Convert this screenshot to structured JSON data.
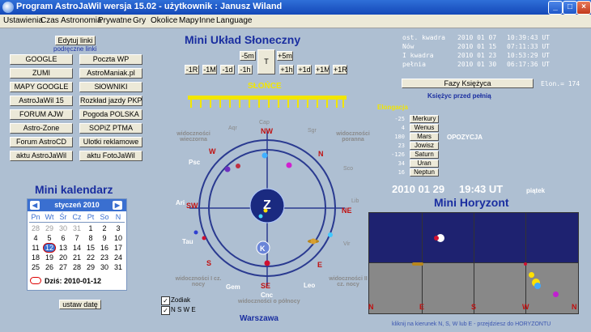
{
  "window": {
    "title": "Program AstroJaWil wersja 15.02 - użytkownik : Janusz Wiland"
  },
  "menu": [
    "Ustawienia",
    "Czas",
    "Astronomia",
    "Prywatne",
    "Gry",
    "Okolice",
    "Mapy",
    "Inne",
    "Language"
  ],
  "links": {
    "edit_button": "Edytuj linki",
    "caption": "podręczne linki",
    "left": [
      "GOOGLE",
      "ZUMI",
      "MAPY GOOGLE",
      "AstroJaWil 15",
      "FORUM AJW",
      "Astro-Zone",
      "Forum AstroCD",
      "aktu AstroJaWil"
    ],
    "right": [
      "Poczta WP",
      "AstroManiak.pl",
      "SłOWNIKI",
      "Rozkład jazdy PKP",
      "Pogoda POLSKA",
      "SOPiZ PTMA",
      "Ulotki reklamowe",
      "aktu FotoJaWil"
    ]
  },
  "calendar": {
    "title": "Mini kalendarz",
    "month": "styczeń 2010",
    "weekdays": [
      "Pn",
      "Wt",
      "Śr",
      "Cz",
      "Pt",
      "So",
      "N"
    ],
    "weeks": [
      [
        "28",
        "29",
        "30",
        "31",
        "1",
        "2",
        "3"
      ],
      [
        "4",
        "5",
        "6",
        "7",
        "8",
        "9",
        "10"
      ],
      [
        "11",
        "12",
        "13",
        "14",
        "15",
        "16",
        "17"
      ],
      [
        "18",
        "19",
        "20",
        "21",
        "22",
        "23",
        "24"
      ],
      [
        "25",
        "26",
        "27",
        "28",
        "29",
        "30",
        "31"
      ]
    ],
    "today_label": "Dziś: 2010-01-12",
    "set_date_button": "ustaw datę"
  },
  "solar": {
    "title": "Mini Układ Słoneczny",
    "sun_label": "SŁOŃCE",
    "buttons_top": [
      "-5m",
      "T",
      "+5m"
    ],
    "buttons_row": [
      "-1R",
      "-1M",
      "-1d",
      "-1h",
      "+1h",
      "+1d",
      "+1M",
      "+1R"
    ],
    "zodiac": [
      "Cap",
      "Sgr",
      "Sco",
      "Lib",
      "Vir",
      "Leo",
      "Cnc",
      "Gem",
      "Tau",
      "Ari",
      "Psc",
      "Aqr"
    ],
    "dirs": [
      "NW",
      "N",
      "NE",
      "E",
      "SE",
      "S",
      "SW",
      "W"
    ],
    "visibility": {
      "evening": "widoczności wieczorna",
      "morning": "widoczności poranna",
      "first_half": "widoczności I cz. nocy",
      "second_half": "widoczności II cz. nocy",
      "midnight": "widoczności o północy"
    },
    "earth_label": "Z",
    "moon_label": "K",
    "location": "Warszawa",
    "chk_zodiac": "Zodiak",
    "chk_nswe": "N S W E"
  },
  "moon_phases": [
    {
      "name": "ost. kwadra",
      "date": "2010 01 07",
      "time": "10:39:43 UT"
    },
    {
      "name": "Nów",
      "date": "2010 01 15",
      "time": "07:11:33 UT"
    },
    {
      "name": "I kwadra",
      "date": "2010 01 23",
      "time": "10:53:29 UT"
    },
    {
      "name": "pełnia",
      "date": "2010 01 30",
      "time": "06:17:36 UT"
    }
  ],
  "moon": {
    "button": "Fazy Księżyca",
    "elongation": "Elon.= 174",
    "status": "Księżyc przed pełnią"
  },
  "elongation": {
    "title": "Elongacja",
    "rows": [
      {
        "value": "-25",
        "planet": "Merkury"
      },
      {
        "value": "4",
        "planet": "Wenus"
      },
      {
        "value": "180",
        "planet": "Mars",
        "note": "OPOZYCJA"
      },
      {
        "value": "23",
        "planet": "Jowisz"
      },
      {
        "value": "-126",
        "planet": "Saturn"
      },
      {
        "value": "34",
        "planet": "Uran"
      },
      {
        "value": "16",
        "planet": "Neptun"
      }
    ]
  },
  "datetime": {
    "date": "2010 01 29",
    "time": "19:43 UT",
    "weekday": "piątek"
  },
  "horizon": {
    "title": "Mini Horyzont",
    "dirs": [
      "N",
      "E",
      "S",
      "W",
      "N"
    ],
    "hint": "kliknij na kierunek N, S, W lub E - przejdziesz do HORYZONTU"
  },
  "colors": {
    "title_blue": "#1a2ea0",
    "orbit_ring": "#2a3a90",
    "sky": "#1e2270",
    "ground": "#888888",
    "sun_bar": "#f2e600"
  }
}
